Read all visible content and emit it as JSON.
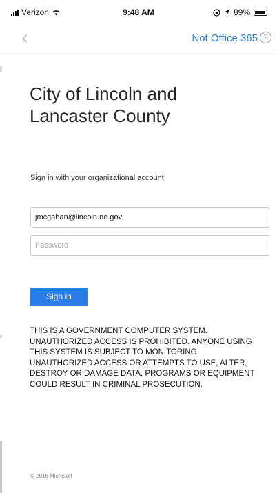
{
  "status_bar": {
    "carrier": "Verizon",
    "time": "9:48 AM",
    "battery": "89%",
    "icons": [
      "signal-icon",
      "wifi-icon",
      "lock-rotation-icon",
      "location-icon",
      "battery-icon"
    ]
  },
  "nav": {
    "back_icon": "chevron-left-icon",
    "not_office_label": "Not Office 365",
    "help_icon": "question-circle-icon"
  },
  "org_title": "City of Lincoln and\nLancaster County",
  "sign_in_prompt": "Sign in with your organizational account",
  "email": {
    "value": "jmcgahan@lincoln.ne.gov"
  },
  "password": {
    "placeholder": "Password"
  },
  "sign_in_label": "Sign in",
  "warning_text": "THIS IS A GOVERNMENT COMPUTER SYSTEM. UNAUTHORIZED ACCESS IS PROHIBITED. ANYONE USING THIS SYSTEM IS SUBJECT TO MONITORING. UNAUTHORIZED ACCESS OR ATTEMPTS TO USE, ALTER, DESTROY OR DAMAGE DATA, PROGRAMS OR EQUIPMENT COULD RESULT IN CRIMINAL PROSECUTION.",
  "copyright": "© 2016 Microsoft",
  "colors": {
    "accent": "#2b7de9",
    "link": "#2a7fd4"
  }
}
